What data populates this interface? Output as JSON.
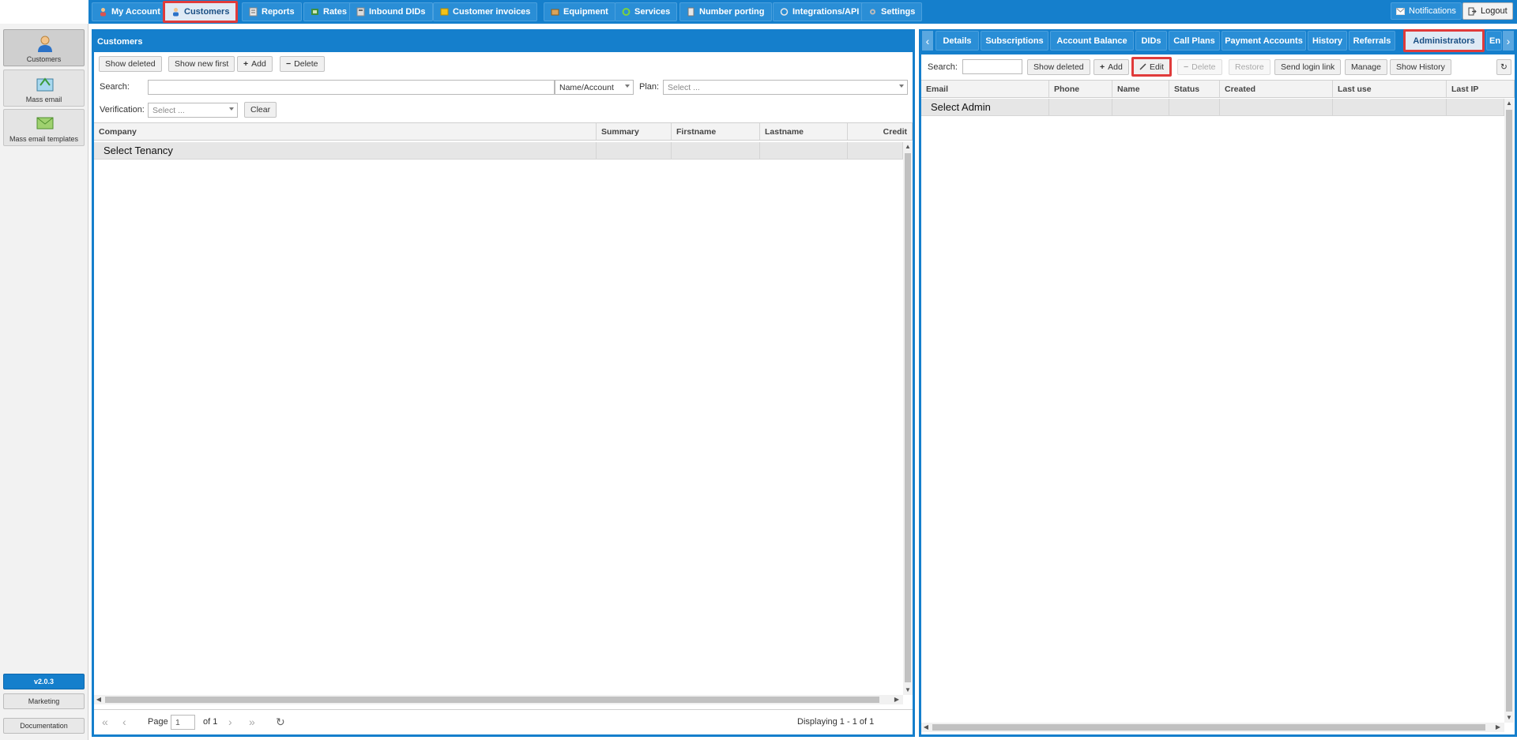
{
  "topnav": {
    "tabs": [
      {
        "label": "My Account",
        "icon": "person-icon",
        "active": false
      },
      {
        "label": "Customers",
        "icon": "customer-icon",
        "active": true
      },
      {
        "label": "Reports",
        "icon": "report-icon",
        "active": false
      },
      {
        "label": "Rates",
        "icon": "rates-icon",
        "active": false
      },
      {
        "label": "Inbound DIDs",
        "icon": "did-icon",
        "active": false
      },
      {
        "label": "Customer invoices",
        "icon": "invoice-icon",
        "active": false
      },
      {
        "label": "Equipment",
        "icon": "equipment-icon",
        "active": false
      },
      {
        "label": "Services",
        "icon": "services-icon",
        "active": false
      },
      {
        "label": "Number porting",
        "icon": "porting-icon",
        "active": false
      },
      {
        "label": "Integrations/API",
        "icon": "api-icon",
        "active": false
      },
      {
        "label": "Settings",
        "icon": "settings-icon",
        "active": false
      }
    ],
    "notifications": "Notifications",
    "logout": "Logout"
  },
  "sidebar": {
    "items": [
      {
        "label": "Customers",
        "icon": "customers-icon",
        "active": true
      },
      {
        "label": "Mass email",
        "icon": "mass-email-icon",
        "active": false
      },
      {
        "label": "Mass email templates",
        "icon": "email-template-icon",
        "active": false
      }
    ],
    "version": "v2.0.3",
    "marketing": "Marketing",
    "documentation": "Documentation"
  },
  "customers_panel": {
    "title": "Customers",
    "toolbar": {
      "show_deleted": "Show deleted",
      "show_new_first": "Show new first",
      "add": "Add",
      "delete": "Delete"
    },
    "search_label": "Search:",
    "search_value": "",
    "search_mode": "Name/Account",
    "plan_label": "Plan:",
    "plan_placeholder": "Select ...",
    "verification_label": "Verification:",
    "verification_placeholder": "Select ...",
    "clear": "Clear",
    "columns": [
      "Company",
      "Summary",
      "Firstname",
      "Lastname",
      "Credit"
    ],
    "rows": [
      [
        "Select Tenancy",
        "",
        "",
        "",
        ""
      ]
    ],
    "pager": {
      "page_label": "Page",
      "page_value": "1",
      "of_label": "of 1",
      "displaying": "Displaying 1 - 1 of 1"
    }
  },
  "detail_tabs": {
    "tabs": [
      {
        "label": "Details",
        "active": false
      },
      {
        "label": "Subscriptions",
        "active": false
      },
      {
        "label": "Account Balance",
        "active": false
      },
      {
        "label": "DIDs",
        "active": false
      },
      {
        "label": "Call Plans",
        "active": false
      },
      {
        "label": "Payment Accounts",
        "active": false
      },
      {
        "label": "History",
        "active": false
      },
      {
        "label": "Referrals",
        "active": false
      },
      {
        "label": "Administrators",
        "active": true
      },
      {
        "label": "En",
        "active": false
      }
    ]
  },
  "admin_panel": {
    "search_label": "Search:",
    "search_value": "",
    "toolbar": {
      "show_deleted": "Show deleted",
      "add": "Add",
      "edit": "Edit",
      "delete": "Delete",
      "restore": "Restore",
      "send_login_link": "Send login link",
      "manage": "Manage",
      "show_history": "Show History"
    },
    "columns": [
      "Email",
      "Phone",
      "Name",
      "Status",
      "Created",
      "Last use",
      "Last IP"
    ],
    "rows": [
      [
        "Select Admin",
        "",
        "",
        "",
        "",
        "",
        ""
      ]
    ]
  },
  "colors": {
    "accent": "#157fcc",
    "highlight": "#e03b3b"
  }
}
